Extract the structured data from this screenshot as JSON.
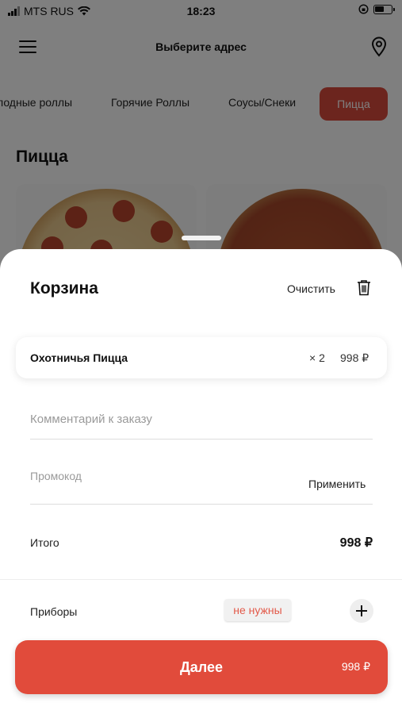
{
  "status_bar": {
    "carrier": "MTS RUS",
    "time": "18:23"
  },
  "header": {
    "title": "Выберите адрес",
    "menu_icon": "hamburger-icon",
    "location_icon": "map-pin-icon"
  },
  "categories": [
    {
      "label": "лодные роллы"
    },
    {
      "label": "Горячие Роллы"
    },
    {
      "label": "Соусы/Снеки"
    },
    {
      "label": "Пицца",
      "active": true
    }
  ],
  "section": {
    "title": "Пицца"
  },
  "cart": {
    "title": "Корзина",
    "clear_label": "Очистить",
    "items": [
      {
        "name": "Охотничья Пицца",
        "qty": "× 2",
        "price": "998 ₽"
      }
    ],
    "comment_placeholder": "Комментарий к заказу",
    "promo_placeholder": "Промокод",
    "apply_label": "Применить",
    "total_label": "Итого",
    "total_value": "998 ₽",
    "utensils_label": "Приборы",
    "utensils_value": "не нужны",
    "next_label": "Далее",
    "next_price": "998 ₽"
  },
  "colors": {
    "accent": "#e14b3b",
    "active_category": "#d94a3d",
    "utensils_text": "#e35a4a"
  }
}
